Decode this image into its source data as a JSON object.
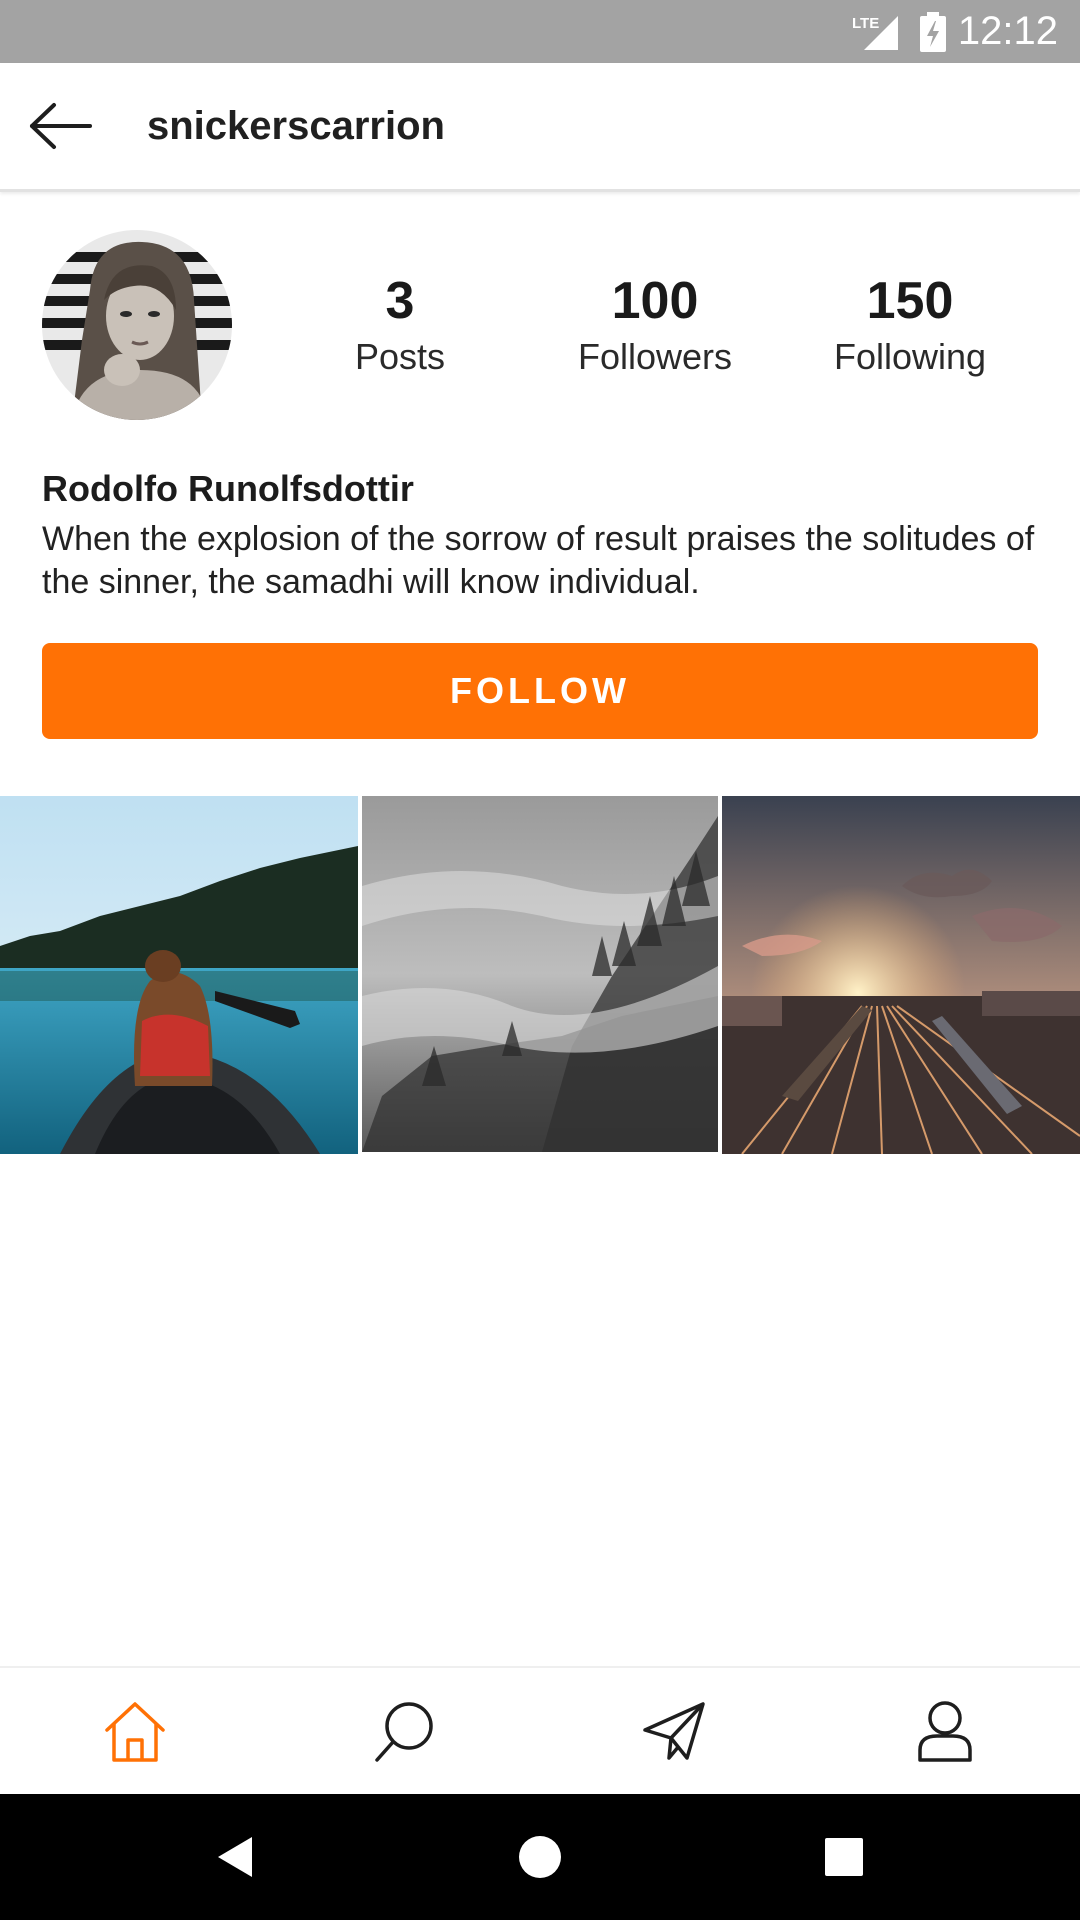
{
  "status_bar": {
    "time": "12:12",
    "network_label": "LTE",
    "icons": [
      "lte-signal-icon",
      "battery-charging-icon"
    ]
  },
  "app_bar": {
    "title": "snickerscarrion",
    "back_icon": "arrow-left-icon"
  },
  "profile": {
    "avatar_icon": "profile-photo",
    "stats": [
      {
        "value": "3",
        "label": "Posts"
      },
      {
        "value": "100",
        "label": "Followers"
      },
      {
        "value": "150",
        "label": "Following"
      }
    ],
    "name": "Rodolfo Runolfsdottir",
    "bio": "When the explosion of the sorrow of result praises the solitudes of the sinner, the samadhi will know individual.",
    "follow_label": "FOLLOW"
  },
  "posts": [
    {
      "subject": "woman-in-canoe-photo"
    },
    {
      "subject": "misty-forest-photo"
    },
    {
      "subject": "rail-yard-sunset-photo"
    }
  ],
  "bottom_nav": {
    "items": [
      {
        "icon": "home-icon",
        "active": true
      },
      {
        "icon": "search-icon",
        "active": false
      },
      {
        "icon": "send-icon",
        "active": false
      },
      {
        "icon": "profile-icon",
        "active": false
      }
    ]
  },
  "system_nav": [
    "back-triangle-icon",
    "home-circle-icon",
    "recents-square-icon"
  ],
  "colors": {
    "accent": "#ff7105",
    "status_bar": "#a3a3a3",
    "nav_bar": "#000000",
    "text": "#1f1f1f"
  }
}
